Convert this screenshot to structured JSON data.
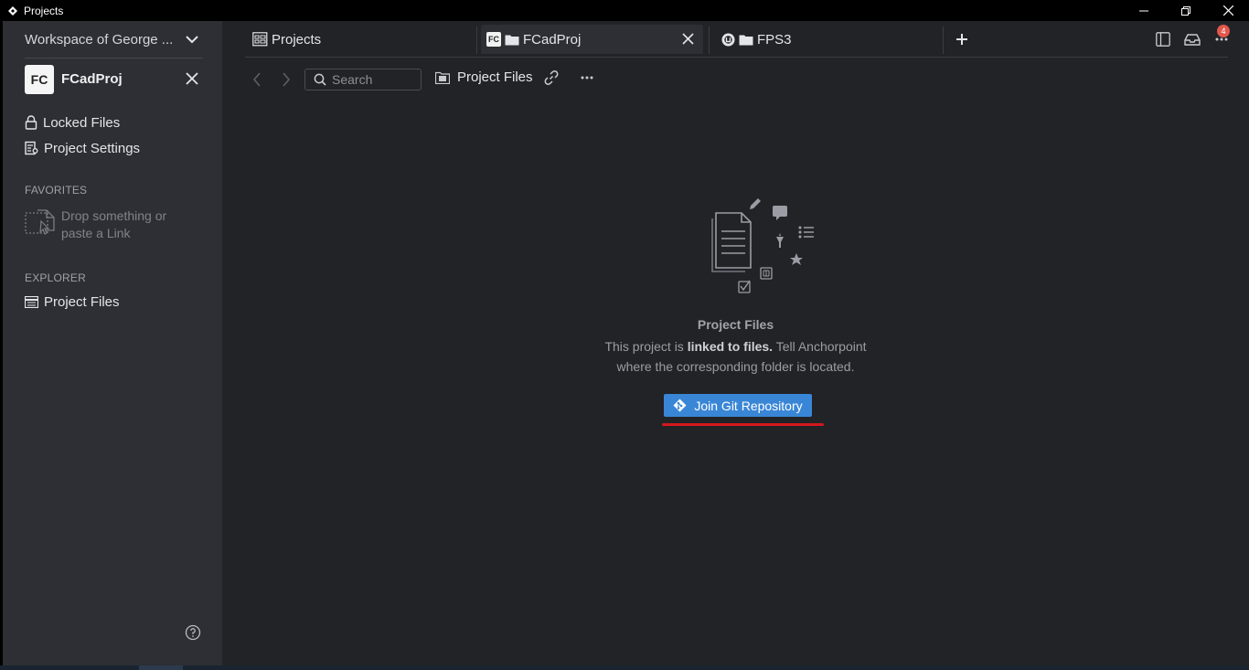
{
  "window": {
    "title": "Projects"
  },
  "sidebar": {
    "workspace_name": "Workspace of George ...",
    "project": {
      "initials": "FC",
      "name": "FCadProj"
    },
    "nav": [
      {
        "label": "Locked Files",
        "icon": "lock-icon"
      },
      {
        "label": "Project Settings",
        "icon": "settings-icon"
      }
    ],
    "favorites": {
      "label": "FAVORITES",
      "drop_text": "Drop something or paste a Link"
    },
    "explorer": {
      "label": "EXPLORER",
      "items": [
        {
          "label": "Project Files",
          "icon": "files-icon"
        }
      ]
    }
  },
  "tabs": [
    {
      "label": "Projects",
      "icon": "projects-icon",
      "active": false
    },
    {
      "label": "FCadProj",
      "initials": "FC",
      "icon": "folder-icon",
      "active": true
    },
    {
      "label": "FPS3",
      "icon": "folder-icon",
      "active": false
    }
  ],
  "notifications": {
    "count": "4"
  },
  "toolbar": {
    "search_placeholder": "Search",
    "breadcrumb": "Project Files"
  },
  "empty_state": {
    "title": "Project Files",
    "desc_prefix": "This project is ",
    "desc_bold": "linked to files.",
    "desc_suffix": " Tell Anchorpoint",
    "desc_line2": "where the corresponding folder is located.",
    "button_label": "Join Git Repository"
  },
  "colors": {
    "accent": "#3a86d6",
    "annotation": "#d4181d",
    "badge": "#e0574d"
  }
}
